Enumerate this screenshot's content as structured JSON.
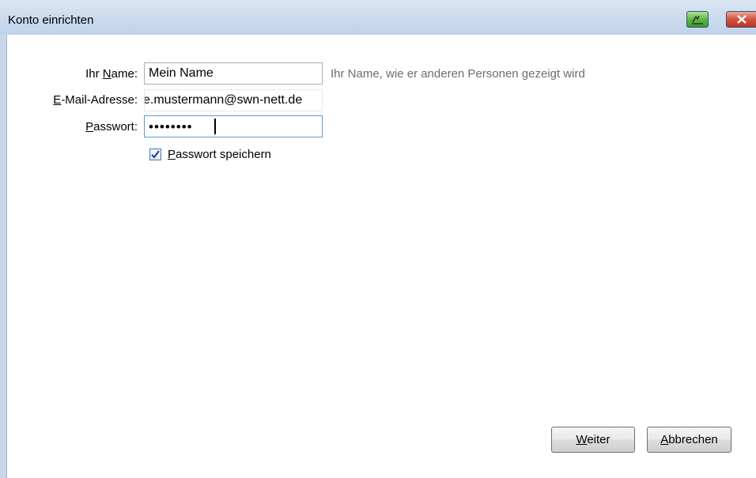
{
  "window": {
    "title": "Konto einrichten"
  },
  "titlebar_buttons": {
    "sign_icon": "signature-icon",
    "close_icon": "close-icon"
  },
  "form": {
    "name": {
      "label_prefix": "Ihr ",
      "label_accel": "N",
      "label_suffix": "ame:",
      "value": "Mein Name",
      "hint": "Ihr Name, wie er anderen Personen gezeigt wird"
    },
    "email": {
      "label_accel": "E",
      "label_suffix": "-Mail-Adresse:",
      "value": "e.mustermann@swn-nett.de"
    },
    "password": {
      "label_accel": "P",
      "label_suffix": "asswort:",
      "value": "••••••••"
    },
    "remember": {
      "checked": true,
      "label_accel": "P",
      "label_suffix": "asswort speichern"
    }
  },
  "buttons": {
    "next_accel": "W",
    "next_suffix": "eiter",
    "cancel_accel": "A",
    "cancel_suffix": "bbrechen"
  },
  "colors": {
    "titlebar": "#cddcee",
    "close_button": "#d2533f",
    "sign_button": "#5eb54a",
    "hint_text": "#6d6d6d",
    "focus_border": "#5a9bd5"
  }
}
